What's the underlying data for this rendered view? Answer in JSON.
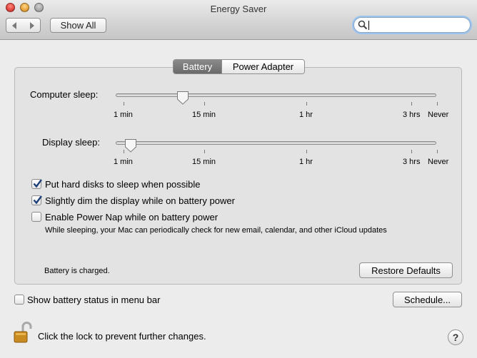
{
  "window": {
    "title": "Energy Saver"
  },
  "toolbar": {
    "show_all_label": "Show All",
    "search_value": "",
    "search_placeholder": ""
  },
  "tabs": [
    {
      "label": "Battery",
      "selected": true
    },
    {
      "label": "Power Adapter",
      "selected": false
    }
  ],
  "computer_sleep": {
    "label": "Computer sleep:",
    "ticks": [
      "1 min",
      "15 min",
      "1 hr",
      "3 hrs",
      "Never"
    ],
    "value": "15 min"
  },
  "display_sleep": {
    "label": "Display sleep:",
    "ticks": [
      "1 min",
      "15 min",
      "1 hr",
      "3 hrs",
      "Never"
    ],
    "value": "2 min"
  },
  "options": [
    {
      "label": "Put hard disks to sleep when possible",
      "checked": true
    },
    {
      "label": "Slightly dim the display while on battery power",
      "checked": true
    },
    {
      "label": "Enable Power Nap while on battery power",
      "checked": false
    }
  ],
  "power_nap_description": "While sleeping, your Mac can periodically check for new email, calendar, and other iCloud updates",
  "battery_status": "Battery is charged.",
  "restore_defaults_label": "Restore Defaults",
  "show_battery_status": {
    "label": "Show battery status in menu bar",
    "checked": false
  },
  "schedule_label": "Schedule...",
  "lock_text": "Click the lock to prevent further changes.",
  "help_label": "?",
  "colors": {
    "accent": "#3b6fd4",
    "selected_tab": "#7a7a7a"
  }
}
